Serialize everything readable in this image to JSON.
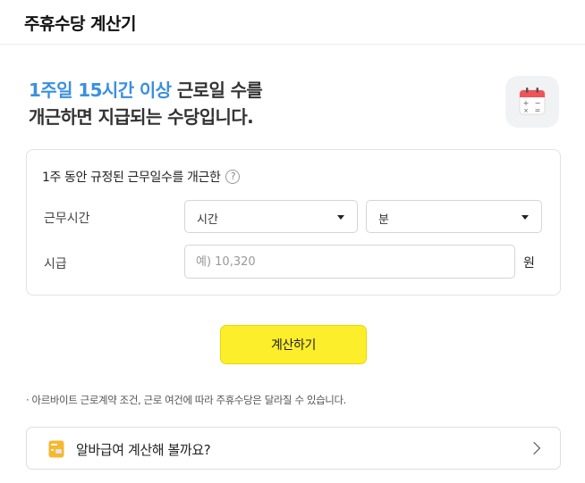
{
  "header": {
    "title": "주휴수당 계산기"
  },
  "intro": {
    "highlight": "1주일 15시간 이상",
    "line1_rest": " 근로일 수를",
    "line2": "개근하면 지급되는 수당입니다."
  },
  "colors": {
    "accent_blue": "#3b8fe0",
    "button_yellow": "#fdee2b",
    "calendar_red": "#f0545a"
  },
  "icons": {
    "calendar": "calendar-calculator-icon",
    "help": "question-circle-icon",
    "link": "wallet-icon",
    "chevron": "chevron-right-icon"
  },
  "form": {
    "caption": "1주 동안 규정된 근무일수를 개근한",
    "help_glyph": "?",
    "work_time_label": "근무시간",
    "hour_select": "시간",
    "minute_select": "분",
    "wage_label": "시급",
    "wage_placeholder": "예) 10,320",
    "wage_value": "",
    "wage_unit": "원"
  },
  "actions": {
    "calculate_label": "계산하기"
  },
  "notice": "· 아르바이트 근로계약 조건, 근로 여건에 따라 주휴수당은 달라질 수 있습니다.",
  "link_card": {
    "label": "알바급여 계산해 볼까요?"
  }
}
